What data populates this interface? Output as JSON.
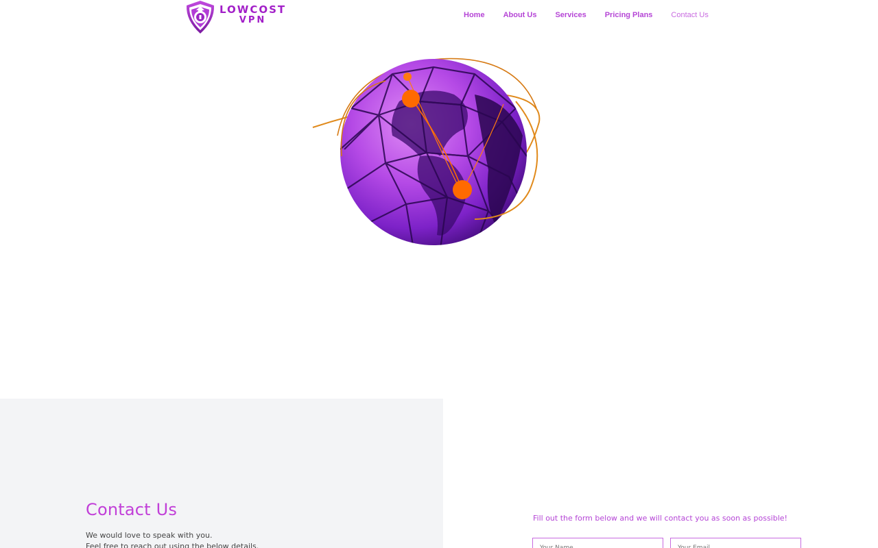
{
  "brand": {
    "logo_line1": "LOWCOST",
    "logo_line2": "VPN",
    "logo_icon": "shield-vpn-icon",
    "accent_color": "#a21fc8"
  },
  "nav": {
    "items": [
      {
        "label": "Home"
      },
      {
        "label": "About Us"
      },
      {
        "label": "Services"
      },
      {
        "label": "Pricing Plans"
      },
      {
        "label": "Contact Us"
      }
    ],
    "active": "Contact Us",
    "color": "#b545d6"
  },
  "hero": {
    "image": "purple-globe-network-illustration"
  },
  "contact": {
    "title": "Contact Us",
    "line1": "We would love to speak with you.",
    "line2": "Feel free to reach out using the below details.",
    "panel_color": "#f3f4f6"
  },
  "form": {
    "intro": "Fill out the form below and we will contact you as soon as possible!",
    "name_placeholder": "Your Name",
    "email_placeholder": "Your Email",
    "border_color": "#c86ae0"
  }
}
